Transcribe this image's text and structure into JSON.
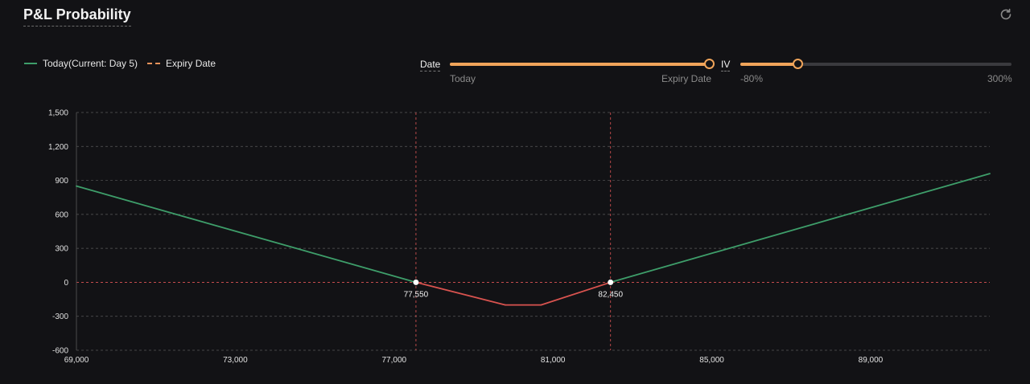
{
  "header": {
    "title": "P&L Probability",
    "refresh_icon": "refresh-icon"
  },
  "legend": {
    "today_label": "Today(Current: Day 5)",
    "expiry_label": "Expiry Date",
    "today_color": "#3e9e6a",
    "expiry_color": "#e8925a"
  },
  "date_slider": {
    "label": "Date",
    "min_label": "Today",
    "max_label": "Expiry Date",
    "value_fraction": 1.0
  },
  "iv_slider": {
    "label": "IV",
    "min_label": "-80%",
    "max_label": "300%",
    "value_fraction": 0.21
  },
  "colors": {
    "profit": "#3e9e6a",
    "loss": "#d9534f",
    "accent": "#f0a45a",
    "grid": "#5a5a5a",
    "marker": "#e05555"
  },
  "chart_data": {
    "type": "line",
    "xlim": [
      69000,
      92000
    ],
    "ylim": [
      -600,
      1500
    ],
    "x_ticks": [
      "69,000",
      "73,000",
      "77,000",
      "81,000",
      "85,000",
      "89,000"
    ],
    "x_tick_values": [
      69000,
      73000,
      77000,
      81000,
      85000,
      89000
    ],
    "y_ticks": [
      "1,500",
      "1,200",
      "900",
      "600",
      "300",
      "0",
      "-300",
      "-600"
    ],
    "y_tick_values": [
      1500,
      1200,
      900,
      600,
      300,
      0,
      -300,
      -600
    ],
    "grid": true,
    "series": [
      {
        "points": [
          [
            69000,
            850
          ],
          [
            77550,
            0
          ],
          [
            79800,
            -200
          ],
          [
            80700,
            -200
          ],
          [
            82450,
            0
          ],
          [
            92000,
            960
          ]
        ]
      }
    ],
    "breakevens": [
      {
        "x": 77550,
        "label": "77,550"
      },
      {
        "x": 82450,
        "label": "82,450"
      }
    ]
  }
}
